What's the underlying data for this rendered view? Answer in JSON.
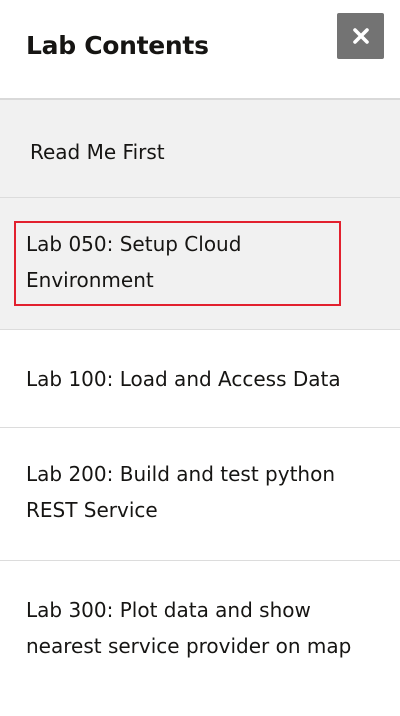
{
  "panel": {
    "title": "Lab Contents",
    "close_icon": "close-icon",
    "close_button_color": "#737373",
    "accent_highlight_color": "#e2202e"
  },
  "items": [
    {
      "label": "Read Me First",
      "selected": true
    },
    {
      "label": "Lab 050: Setup Cloud Environment",
      "selected": true,
      "highlighted": true
    },
    {
      "label": "Lab 100: Load and Access Data",
      "selected": false
    },
    {
      "label": "Lab 200: Build and test python REST Service",
      "selected": false
    },
    {
      "label": "Lab 300: Plot data and show nearest service provider on map",
      "selected": false
    }
  ]
}
